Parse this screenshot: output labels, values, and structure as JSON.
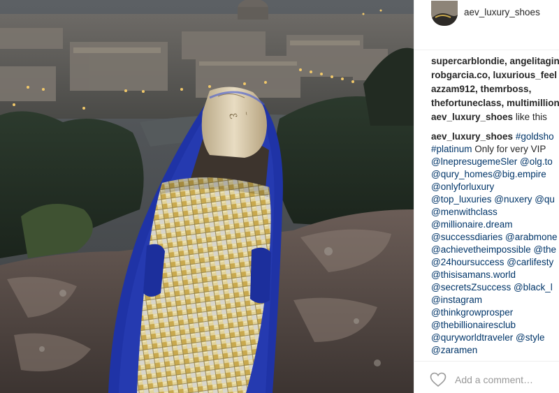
{
  "post": {
    "username": "aev_luxury_shoes",
    "likes": {
      "lines": [
        [
          "supercarblondie,",
          " angelitagin"
        ],
        [
          "robgarcia.co,",
          " luxurious_feel"
        ],
        [
          "azzam912,",
          " themrboss,"
        ],
        [
          "thefortuneclass,",
          " multimillion"
        ]
      ],
      "last_user": "aev_luxury_shoes",
      "suffix": " like this"
    },
    "caption": {
      "author": "aev_luxury_shoes",
      "first_tag": "#goldsho",
      "lines": [
        [
          {
            "t": "#platinum",
            "tag": true
          },
          {
            "t": " Only for very VIP",
            "tag": false
          }
        ],
        [
          {
            "t": "@lnepresugemeSler @olg.to",
            "tag": true
          }
        ],
        [
          {
            "t": "@qury_homes@big.empire",
            "tag": true
          }
        ],
        [
          {
            "t": "@onlyforluxury",
            "tag": true
          }
        ],
        [
          {
            "t": "@top_luxuries @nuxery @qu",
            "tag": true
          }
        ],
        [
          {
            "t": "@menwithclass",
            "tag": true
          }
        ],
        [
          {
            "t": "@millionaire.dream",
            "tag": true
          }
        ],
        [
          {
            "t": "@successdiaries @arabmone",
            "tag": true
          }
        ],
        [
          {
            "t": "@achievetheimpossible @the",
            "tag": true
          }
        ],
        [
          {
            "t": "@24hoursuccess @carlifesty",
            "tag": true
          }
        ],
        [
          {
            "t": "@thisisamans.world",
            "tag": true
          }
        ],
        [
          {
            "t": "@secretsZsuccess @black_l",
            "tag": true
          }
        ],
        [
          {
            "t": "@instagram",
            "tag": true
          }
        ],
        [
          {
            "t": "@thinkgrowprosper",
            "tag": true
          }
        ],
        [
          {
            "t": "@thebillionairesclub",
            "tag": true
          }
        ],
        [
          {
            "t": "@quryworldtraveler @style",
            "tag": true
          }
        ],
        [
          {
            "t": "@zaramen",
            "tag": true
          }
        ]
      ]
    },
    "comment_placeholder": "Add a comment…",
    "link_color": "#003569",
    "text_color": "#262626"
  },
  "photo": {
    "shoe_color": "#1f33a6",
    "weave_gold": "#c9a94e",
    "weave_silver": "#dcdcd4"
  }
}
